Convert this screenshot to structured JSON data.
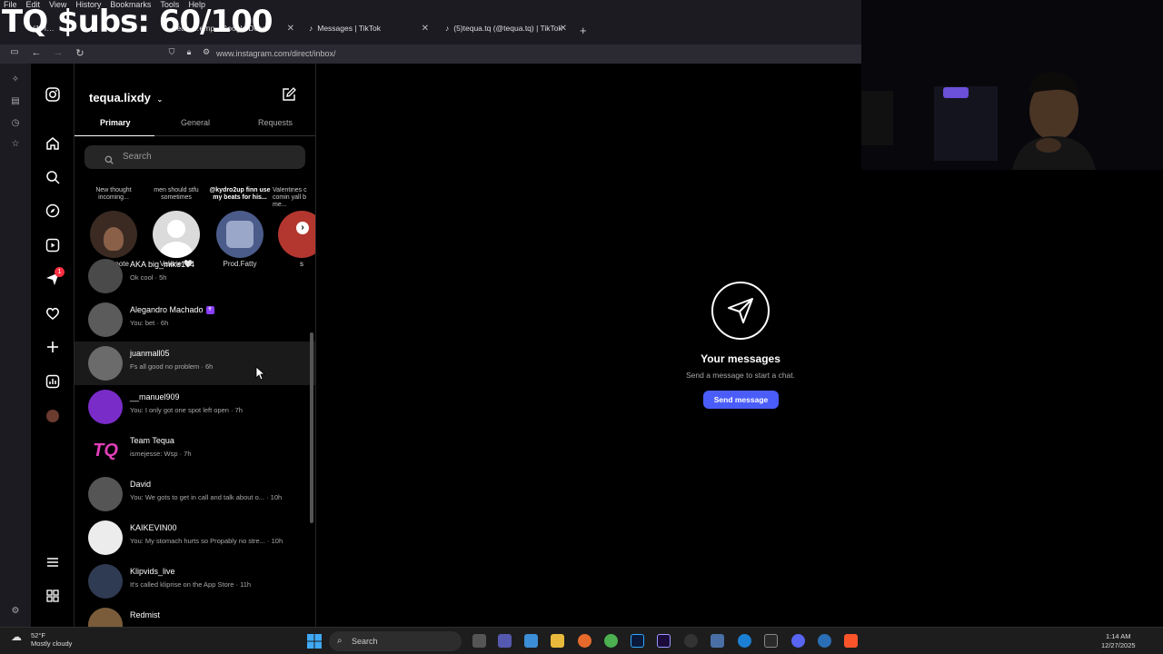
{
  "overlay": {
    "title": "TQ $ubs: 60/100"
  },
  "menubar": [
    "File",
    "Edit",
    "View",
    "History",
    "Bookmarks",
    "Tools",
    "Help"
  ],
  "tabs": [
    {
      "label": "(1) I…"
    },
    {
      "label": "…ean …emp - Google Docs"
    },
    {
      "label": "Messages | TikTok"
    },
    {
      "label": "(5)tequa.tq (@tequa.tq) | TikTok"
    }
  ],
  "url": "www.instagram.com/direct/inbox/",
  "dm": {
    "username": "tequa.lixdy",
    "tabs": [
      "Primary",
      "General",
      "Requests"
    ],
    "search_placeholder": "Search",
    "notes": [
      {
        "bubble": "New thought incoming...",
        "name": "Your note"
      },
      {
        "bubble": "men should stfu sometimes",
        "name": "Valerie 🤍"
      },
      {
        "bubble": "@kydro2up finn use my beats for his...",
        "name": "Prod.Fatty"
      },
      {
        "bubble": "Valentines c comin yall b me...",
        "name": "s"
      }
    ],
    "conversations": [
      {
        "name": "AKA big_mike174",
        "preview": "Ok cool · 5h",
        "color": "#4a4a4a"
      },
      {
        "name": "Alegandro Machado",
        "preview": "You: bet · 6h",
        "color": "#5b5b5b",
        "badge": true
      },
      {
        "name": "juanmall05",
        "preview": "Fs all good no problem · 6h",
        "color": "#6b6b6b",
        "hover": true
      },
      {
        "name": "__manuel909",
        "preview": "You: I only got one spot left open · 7h",
        "color": "#7a2cc9"
      },
      {
        "name": "Team Tequa",
        "preview": "ismejesse: Wsp · 7h",
        "color": "#e23fb8"
      },
      {
        "name": "David",
        "preview": "You: We gots to get in call and talk about o... · 10h",
        "color": "#555"
      },
      {
        "name": "KAIKEVIN00",
        "preview": "You: My stomach hurts so Propably no stre... · 10h",
        "color": "#ececec"
      },
      {
        "name": "Klipvids_live",
        "preview": "It's called kliprise on the App Store · 11h",
        "color": "#2f3b52"
      },
      {
        "name": "Redmist",
        "preview": "",
        "color": "#7a5c3a"
      }
    ]
  },
  "main": {
    "title": "Your messages",
    "subtitle": "Send a message to start a chat.",
    "button": "Send message"
  },
  "taskbar": {
    "weather_temp": "52°F",
    "weather_desc": "Mostly cloudy",
    "search": "Search",
    "time": "1:14 AM",
    "date": "12/27/2025"
  },
  "notifications": {
    "count": "1"
  }
}
